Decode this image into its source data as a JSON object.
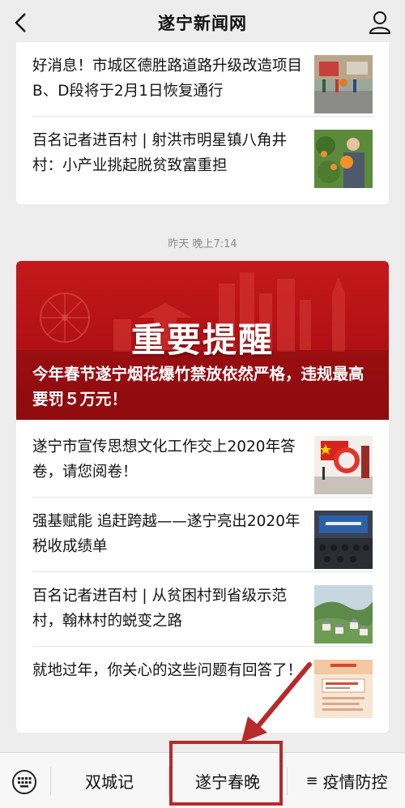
{
  "header": {
    "title": "遂宁新闻网"
  },
  "top_items": [
    {
      "text": "好消息！市城区德胜路道路升级改造项目B、D段将于2月1日恢复通行",
      "thumb": "road-photo"
    },
    {
      "text": "百名记者进百村 | 射洪市明星镇八角井村：小产业挑起脱贫致富重担",
      "thumb": "orange-farmer-photo"
    }
  ],
  "timestamp": "昨天 晚上7:14",
  "hero": {
    "banner_text": "重要提醒",
    "caption": "今年春节遂宁烟花爆竹禁放依然严格，违规最高要罚５万元！"
  },
  "main_items": [
    {
      "text": "遂宁市宣传思想文化工作交上2020年答卷，请您阅卷！",
      "thumb": "flag-exhibit-photo"
    },
    {
      "text": "强基赋能 追赶跨越——遂宁亮出2020年税收成绩单",
      "thumb": "meeting-photo"
    },
    {
      "text": "百名记者进百村 | 从贫困村到省级示范村，翰林村的蜕变之路",
      "thumb": "village-photo"
    },
    {
      "text": "就地过年，你关心的这些问题有回答了！",
      "thumb": "poster-photo"
    }
  ],
  "bottom_nav": {
    "tab1": "双城记",
    "tab2": "遂宁春晚",
    "tab3_glyph": "≡",
    "tab3": "疫情防控"
  },
  "colors": {
    "accent_red": "#b8292a",
    "banner_red": "#c4191b",
    "background": "#ededed"
  }
}
